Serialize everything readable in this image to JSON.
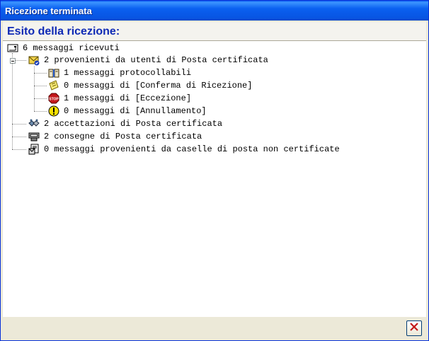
{
  "window": {
    "title": "Ricezione terminata"
  },
  "header": {
    "title": "Esito della ricezione:"
  },
  "tree": {
    "root": {
      "label": "6 messaggi ricevuti",
      "icon": "message-root-icon"
    },
    "certified": {
      "label": "2 provenienti da utenti di Posta certificata",
      "icon": "certified-mail-icon",
      "expanded": true
    },
    "certified_children": [
      {
        "label": "1 messaggi protocollabili",
        "icon": "book-icon"
      },
      {
        "label": "0 messaggi di [Conferma di Ricezione]",
        "icon": "note-icon"
      },
      {
        "label": "1 messaggi di [Eccezione]",
        "icon": "stop-icon"
      },
      {
        "label": "0 messaggi di [Annullamento]",
        "icon": "warning-icon"
      }
    ],
    "acceptances": {
      "label": "2 accettazioni di Posta certificata",
      "icon": "handshake-icon"
    },
    "deliveries": {
      "label": "2 consegne di Posta certificata",
      "icon": "delivery-icon"
    },
    "noncertified": {
      "label": "0 messaggi provenienti da caselle di posta non certificate",
      "icon": "document-icon"
    }
  },
  "footer": {
    "close_button": "close-icon"
  }
}
